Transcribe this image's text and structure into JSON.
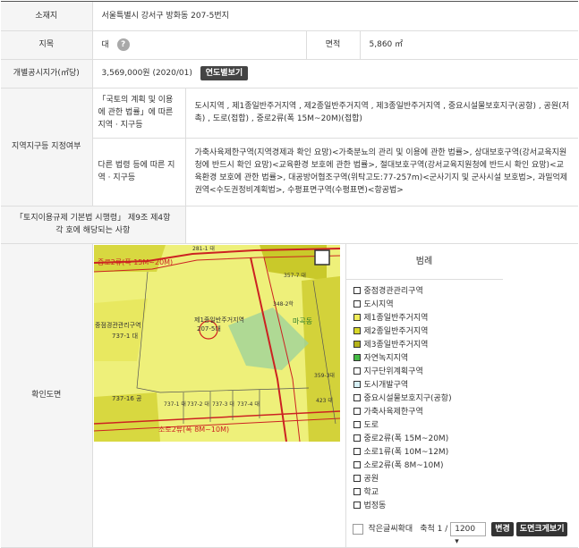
{
  "location": {
    "label": "소재지",
    "value": "서울특별시 강서구 방화동 207-5번지"
  },
  "land_category": {
    "label": "지목",
    "value": "대",
    "help_icon": "?"
  },
  "area": {
    "label": "면적",
    "value": "5,860 ㎡"
  },
  "official_price": {
    "label": "개별공시지가(㎡당)",
    "value": "3,569,000원 (2020/01)",
    "button": "연도별보기"
  },
  "zone": {
    "label": "지역지구등 지정여부",
    "national_label": "「국토의 계획 및 이용에 관한 법률」에 따른 지역 · 지구등",
    "national_value": "도시지역 , 제1종일반주거지역 , 제2종일반주거지역 , 제3종일반주거지역 , 중요시설물보호지구(공항) , 공원(저촉) , 도로(접합) , 중로2류(폭 15M~20M)(접합)",
    "other_label": "다른 법령 등에 따른 지역 · 지구등",
    "other_value": "가축사육제한구역(지역경제과 확인 요망)<가축분뇨의 관리 및 이용에 관한 법률>, 상대보호구역(강서교육지원청에 반드시 확인 요망)<교육환경 보호에 관한 법률>, 절대보호구역(강서교육지원청에 반드시 확인 요망)<교육환경 보호에 관한 법률>, 대공방어협조구역(위탁고도:77-257m)<군사기지 및 군사시설 보호법>, 과밀억제권역<수도권정비계획법>, 수평표면구역(수평표면)<항공법>"
  },
  "regulation": {
    "label": "「토지이용규제 기본법 시행령」 제9조 제4항 각 호에 해당되는 사항",
    "value": ""
  },
  "map_section": {
    "label": "확인도면",
    "legend_title": "범례",
    "legend": [
      {
        "label": "중점경관관리구역",
        "color": "#ffffff"
      },
      {
        "label": "도시지역",
        "color": "#ffffff"
      },
      {
        "label": "제1종일반주거지역",
        "color": "#f1ee5a"
      },
      {
        "label": "제2종일반주거지역",
        "color": "#d8d72a"
      },
      {
        "label": "제3종일반주거지역",
        "color": "#b5b31a"
      },
      {
        "label": "자연녹지지역",
        "color": "#44bb44"
      },
      {
        "label": "지구단위계획구역",
        "color": "#ffffff"
      },
      {
        "label": "도시개발구역",
        "color": "#d6f0f5"
      },
      {
        "label": "중요시설물보호지구(공항)",
        "color": "#ffffff"
      },
      {
        "label": "가축사육제한구역",
        "color": "#ffffff"
      },
      {
        "label": "도로",
        "color": "#ffffff"
      },
      {
        "label": "중로2류(폭 15M~20M)",
        "color": "#ffffff"
      },
      {
        "label": "소로1류(폭 10M~12M)",
        "color": "#ffffff"
      },
      {
        "label": "소로2류(폭 8M~10M)",
        "color": "#ffffff"
      },
      {
        "label": "공원",
        "color": "#ffffff"
      },
      {
        "label": "학교",
        "color": "#ffffff"
      },
      {
        "label": "법정동",
        "color": "#ffffff"
      }
    ],
    "font_toggle": "작은글씨확대",
    "scale_label": "축척 1 /",
    "scale_value": "1200",
    "change_button": "변경",
    "enlarge_button": "도면크게보기",
    "map_labels": {
      "road_top": "중로2류(폭 15M~20M)",
      "road_bottom": "소로2류(폭 8M~10M)",
      "zone_left": "중점경관관리구역",
      "zone_center": "제1종일반주거지역",
      "parcel_center": "207-5대",
      "dong": "마곡동",
      "lot_left": "737-1 대",
      "lot_left2": "737-16 공",
      "lot_bottom1": "737-1 대",
      "lot_bottom2": "737-2 대",
      "lot_bottom3": "737-3 대",
      "lot_bottom4": "737-4 대",
      "lot_r1": "357-7 대",
      "lot_r2": "359-3대",
      "lot_r3": "423 대",
      "lot_top": "281-1 대",
      "lot_mid": "348-2학"
    }
  }
}
